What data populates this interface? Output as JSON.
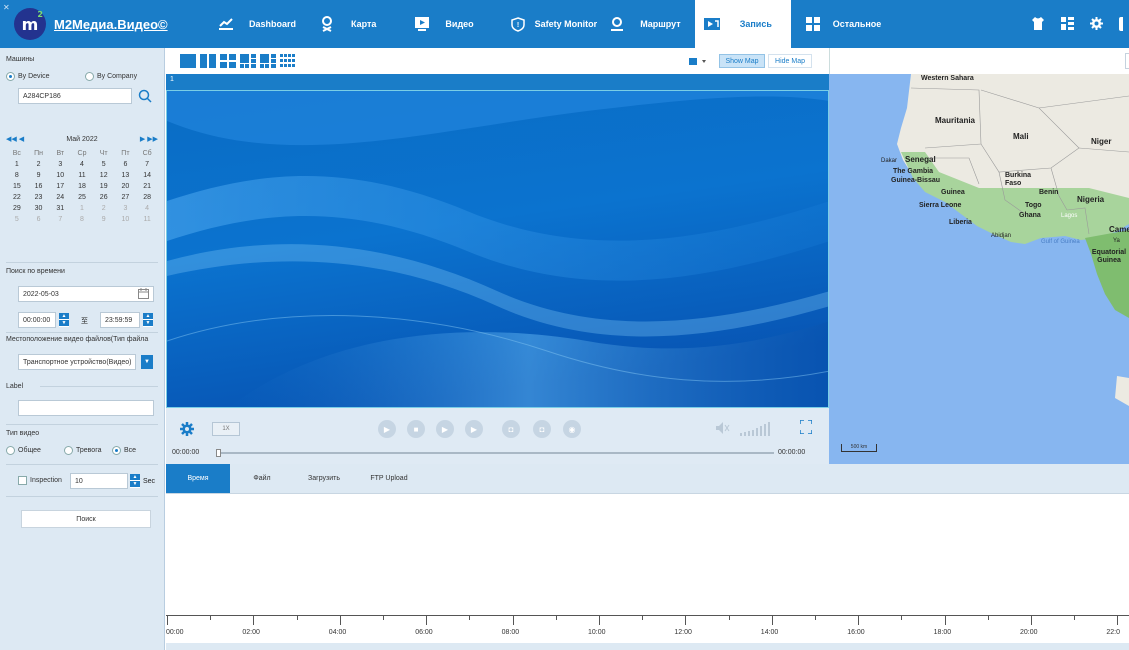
{
  "app": {
    "title": "M2Медиа.Видео©"
  },
  "nav": [
    {
      "label": "Dashboard",
      "icon": "chart-icon"
    },
    {
      "label": "Карта",
      "icon": "map-pin-icon"
    },
    {
      "label": "Видео",
      "icon": "video-play-icon"
    },
    {
      "label": "Safety Monitor",
      "icon": "shield-icon"
    },
    {
      "label": "Маршрут",
      "icon": "route-icon"
    },
    {
      "label": "Запись",
      "icon": "record-icon",
      "active": true
    },
    {
      "label": "Остальное",
      "icon": "apps-icon"
    }
  ],
  "left": {
    "machines_title": "Машины",
    "by_device": "By Device",
    "by_company": "By Company",
    "device_value": "A284CP186",
    "calendar": {
      "month_label": "Май 2022",
      "weekdays": [
        "Вс",
        "Пн",
        "Вт",
        "Ср",
        "Чт",
        "Пт",
        "Сб"
      ],
      "weeks": [
        [
          "1",
          "2",
          "3",
          "4",
          "5",
          "6",
          "7"
        ],
        [
          "8",
          "9",
          "10",
          "11",
          "12",
          "13",
          "14"
        ],
        [
          "15",
          "16",
          "17",
          "18",
          "19",
          "20",
          "21"
        ],
        [
          "22",
          "23",
          "24",
          "25",
          "26",
          "27",
          "28"
        ],
        [
          "29",
          "30",
          "31",
          "1",
          "2",
          "3",
          "4"
        ],
        [
          "5",
          "6",
          "7",
          "8",
          "9",
          "10",
          "11"
        ]
      ]
    },
    "time_search_title": "Поиск по времени",
    "date_value": "2022-05-03",
    "time_from": "00:00:00",
    "time_to_separator": "至",
    "time_to": "23:59:59",
    "location_title": "Местоположение видео файлов(Тип файла",
    "location_value": "Транспортное устройство(Видео)",
    "label_title": "Label",
    "label_value": "",
    "video_type_title": "Тип видео",
    "video_types": [
      "Общее",
      "Тревога",
      "Все"
    ],
    "inspection_label": "Inspection",
    "inspection_value": "10",
    "inspection_unit": "Sec",
    "search_button": "Поиск"
  },
  "video": {
    "channel_label": "1",
    "speed": "1X",
    "time_start": "00:00:00",
    "time_end": "00:00:00",
    "show_map": "Show Map",
    "hide_map": "Hide Map"
  },
  "map": {
    "labels": [
      "Western Sahara",
      "Mauritania",
      "Mali",
      "Niger",
      "Dakar",
      "Senegal",
      "The Gambia",
      "Guinea-Bissau",
      "Burkina Faso",
      "Guinea",
      "Benin",
      "Nigeria",
      "Sierra Leone",
      "Togo",
      "Ghana",
      "Lagos",
      "Liberia",
      "Abidjan",
      "Gulf of Guinea",
      "Came",
      "Ya",
      "Equatorial Guinea"
    ],
    "scale": "500 km"
  },
  "tabs": [
    "Время",
    "Файл",
    "Загрузить",
    "FTP Upload"
  ],
  "timeline": {
    "labels": [
      "00:00",
      "02:00",
      "04:00",
      "06:00",
      "08:00",
      "10:00",
      "12:00",
      "14:00",
      "16:00",
      "18:00",
      "20:00",
      "22:0"
    ]
  },
  "colors": {
    "brand": "#1a7dc8",
    "panel": "#dde9f3",
    "map_water": "#87b6f0",
    "map_land": "#eceae2",
    "map_forest": "#a8d49c"
  }
}
